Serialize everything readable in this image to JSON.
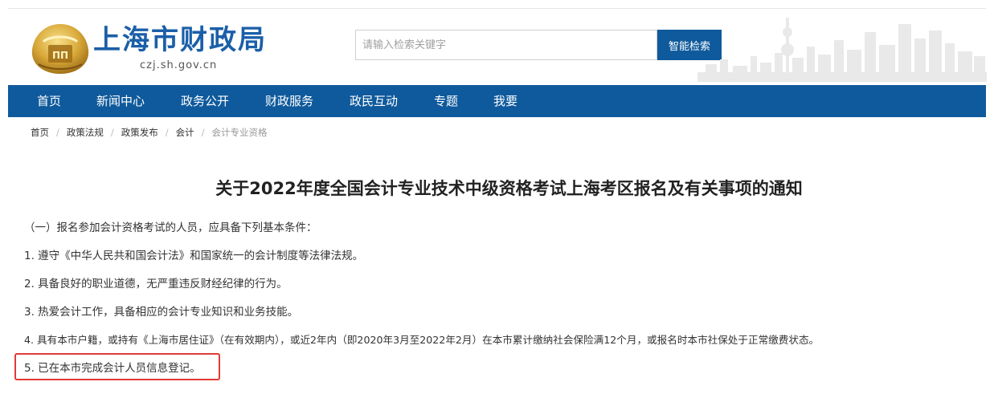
{
  "header": {
    "site_name": "上海市财政局",
    "site_domain": "czj.sh.gov.cn",
    "search": {
      "placeholder": "请输入检索关键字",
      "button_label": "智能检索"
    }
  },
  "nav": {
    "items": [
      {
        "label": "首页"
      },
      {
        "label": "新闻中心"
      },
      {
        "label": "政务公开"
      },
      {
        "label": "财政服务"
      },
      {
        "label": "政民互动"
      },
      {
        "label": "专题"
      },
      {
        "label": "我要"
      }
    ]
  },
  "breadcrumb": {
    "items": [
      {
        "label": "首页"
      },
      {
        "label": "政策法规"
      },
      {
        "label": "政策发布"
      },
      {
        "label": "会计"
      },
      {
        "label": "会计专业资格"
      }
    ],
    "separator": "/"
  },
  "article": {
    "title": "关于2022年度全国会计专业技术中级资格考试上海考区报名及有关事项的通知",
    "paragraphs": [
      "（一）报名参加会计资格考试的人员，应具备下列基本条件：",
      "1. 遵守《中华人民共和国会计法》和国家统一的会计制度等法律法规。",
      "2. 具备良好的职业道德，无严重违反财经纪律的行为。",
      "3. 热爱会计工作，具备相应的会计专业知识和业务技能。",
      "4. 具有本市户籍，或持有《上海市居住证》（在有效期内），或近2年内（即2020年3月至2022年2月）在本市累计缴纳社会保险满12个月，或报名时本市社保处于正常缴费状态。",
      "5. 已在本市完成会计人员信息登记。"
    ]
  },
  "colors": {
    "brand_blue": "#0f5a9c",
    "title_blue": "#1b5fa8",
    "highlight_red": "#e23b36"
  }
}
